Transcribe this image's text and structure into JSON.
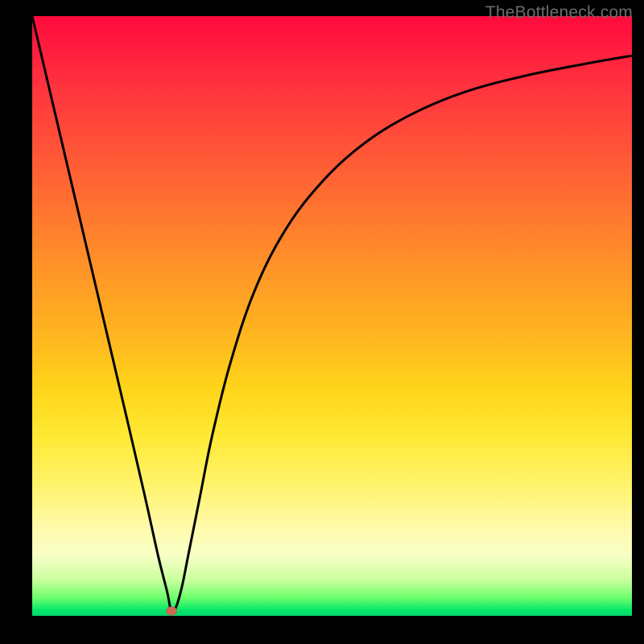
{
  "watermark": "TheBottleneck.com",
  "chart_data": {
    "type": "line",
    "title": "",
    "xlabel": "",
    "ylabel": "",
    "xlim": [
      0,
      100
    ],
    "ylim": [
      0,
      100
    ],
    "grid": false,
    "series": [
      {
        "name": "curve",
        "x": [
          0,
          4,
          8,
          12,
          16,
          19,
          21,
          22.5,
          23.2,
          24,
          25,
          26,
          28,
          30,
          33,
          37,
          42,
          48,
          55,
          63,
          72,
          82,
          92,
          100
        ],
        "y": [
          100,
          83,
          66,
          49,
          32,
          19,
          10,
          4,
          0.8,
          1.5,
          5,
          10,
          20,
          30,
          42,
          54,
          64,
          72,
          78.5,
          83.5,
          87.3,
          90,
          92,
          93.4
        ]
      }
    ],
    "marker": {
      "x": 23.2,
      "y": 0.8
    },
    "colors": {
      "curve": "#000000",
      "marker": "#cf6a57",
      "gradient_top": "#ff0a3c",
      "gradient_bottom": "#02d86c"
    }
  }
}
